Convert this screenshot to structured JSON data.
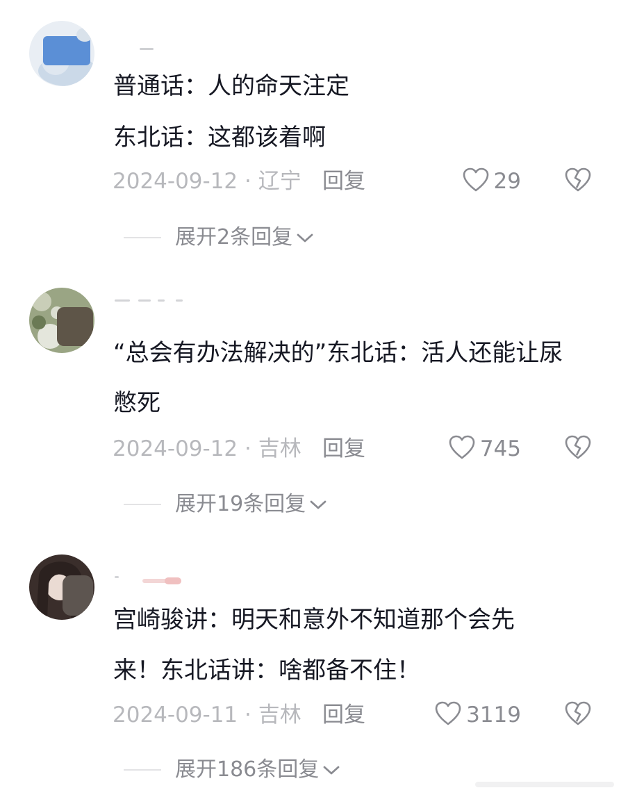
{
  "comments": [
    {
      "text_lines": [
        "普通话：人的命天注定",
        "东北话：这都该着啊"
      ],
      "date_location": "2024-09-12 · 辽宁",
      "reply_label": "回复",
      "likes": "29",
      "expand_label": "展开2条回复",
      "avatar_colors": [
        "#c9d8ea",
        "#5b8fd6"
      ]
    },
    {
      "text_lines": [
        "“总会有办法解决的”东北话：活人还能让尿",
        "憋死"
      ],
      "date_location": "2024-09-12 · 吉林",
      "reply_label": "回复",
      "likes": "745",
      "expand_label": "展开19条回复",
      "avatar_colors": [
        "#7c8b6a",
        "#5e5548"
      ]
    },
    {
      "text_lines": [
        "宫崎骏讲：明天和意外不知道那个会先",
        "来！东北话讲：啥都备不住！"
      ],
      "date_location": "2024-09-11 · 吉林",
      "reply_label": "回复",
      "likes": "3119",
      "expand_label": "展开186条回复",
      "avatar_colors": [
        "#e8d6cf",
        "#3a2e2b"
      ]
    }
  ],
  "icons": {
    "like": "heart-outline-icon",
    "dislike": "broken-heart-icon",
    "expand": "chevron-down-icon"
  },
  "colors": {
    "primary_text": "#161823",
    "meta_text": "#b7b8bc",
    "secondary_text": "#8a8b91",
    "icon_stroke": "#8a8b91"
  }
}
